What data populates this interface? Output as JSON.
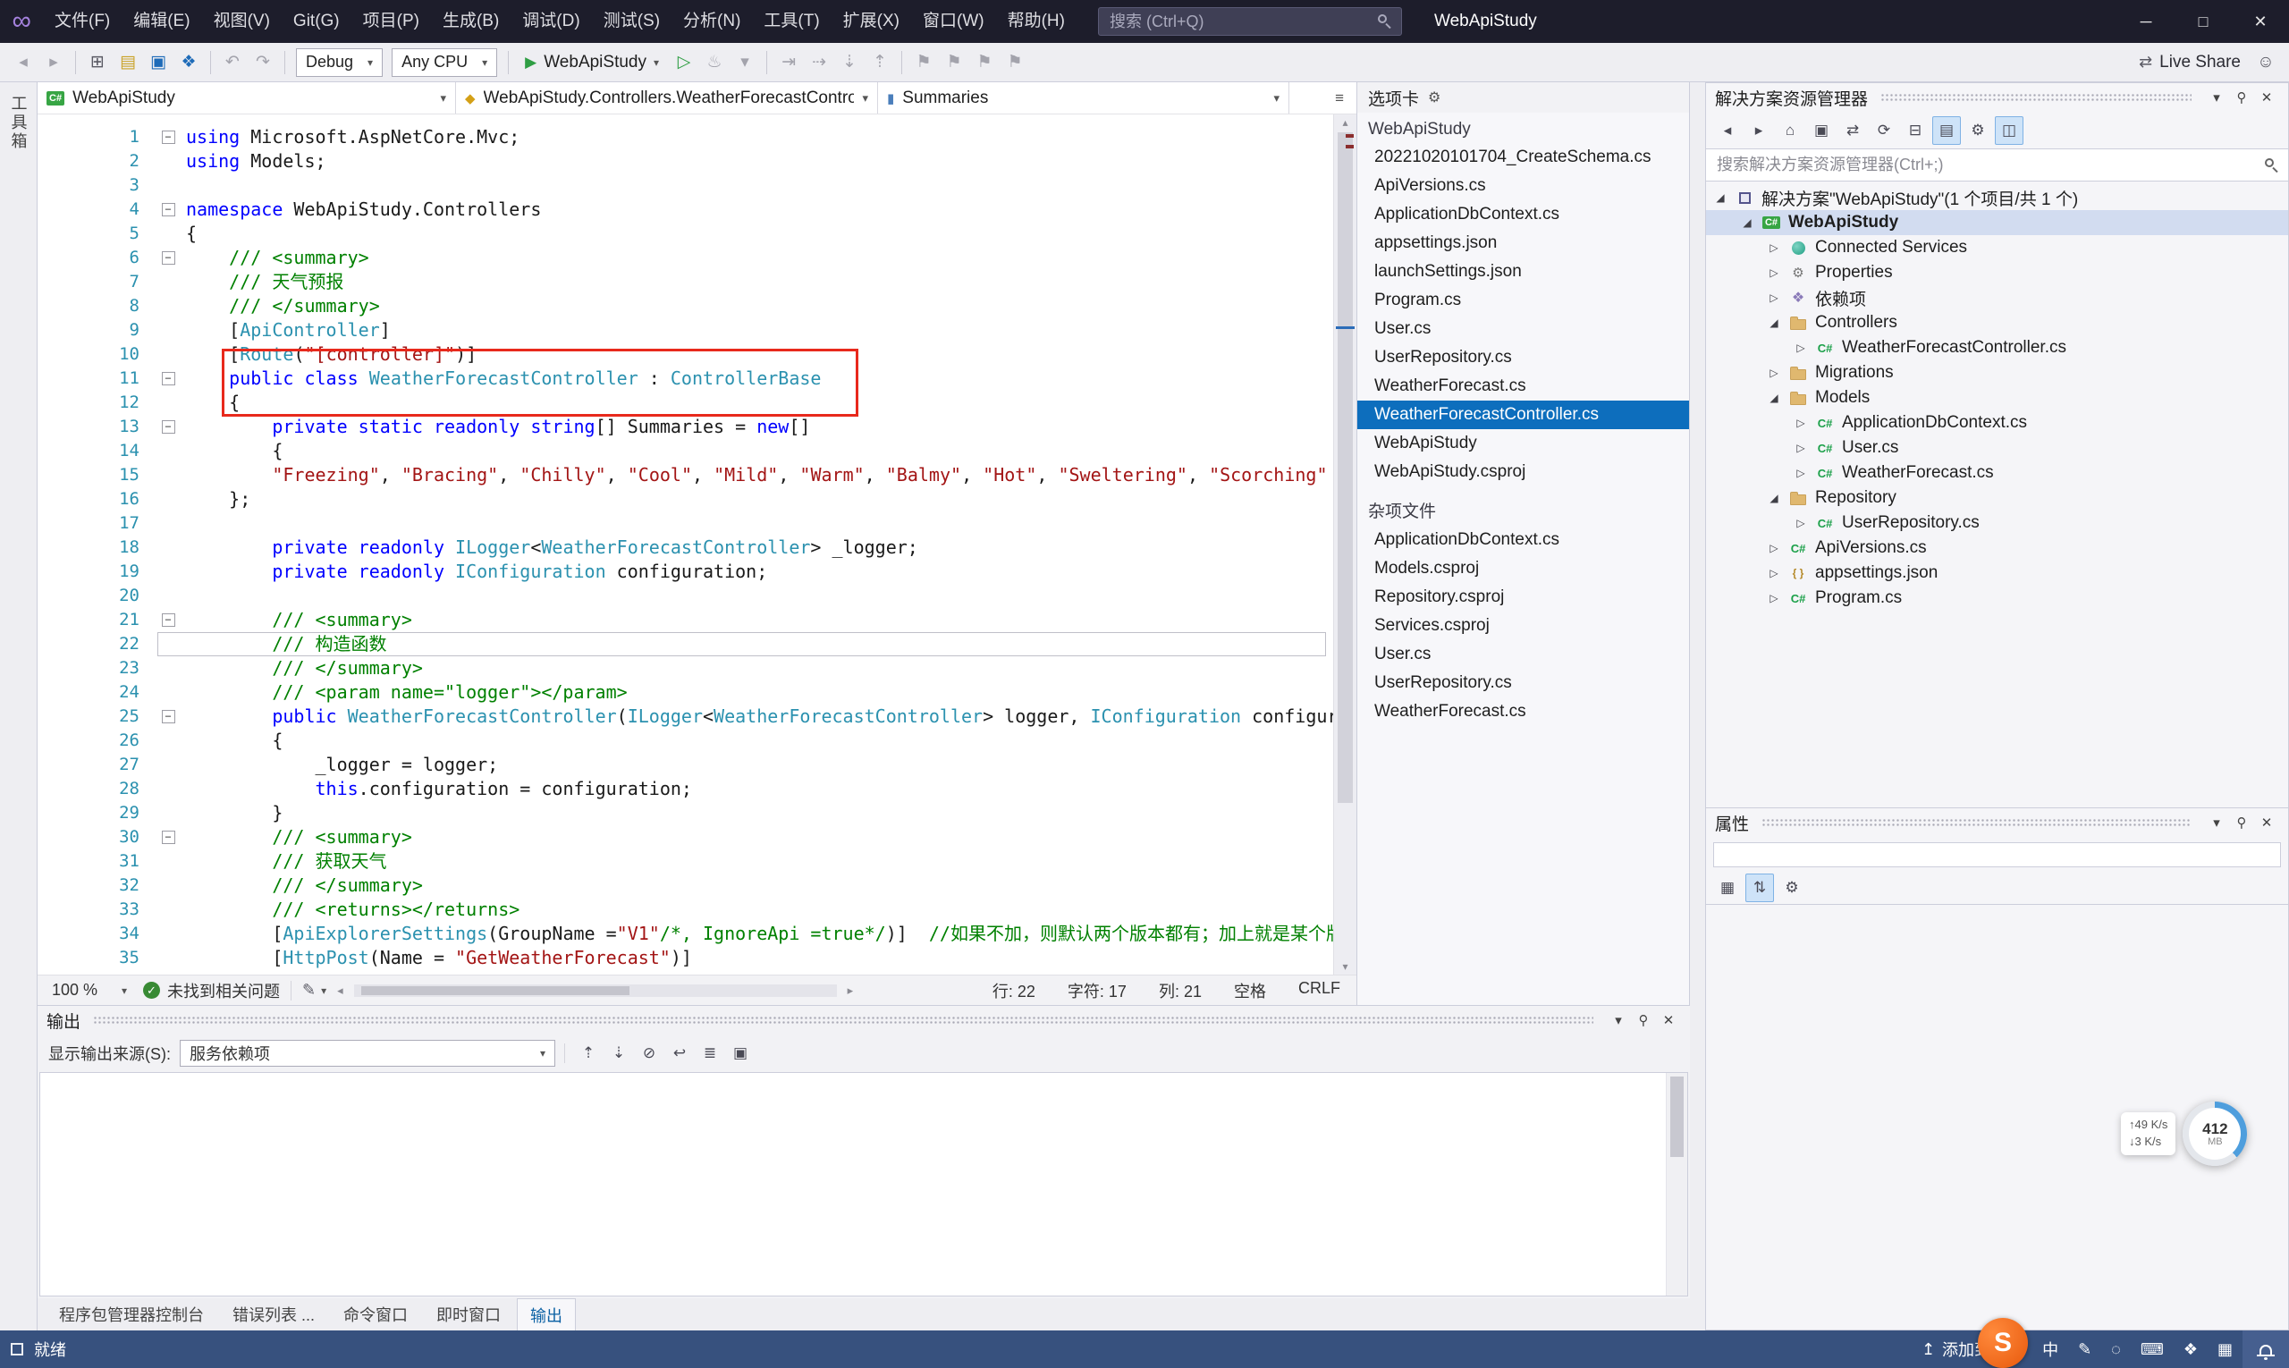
{
  "title_bar": {
    "logo_glyph": "∞",
    "menus": [
      "文件(F)",
      "编辑(E)",
      "视图(V)",
      "Git(G)",
      "项目(P)",
      "生成(B)",
      "调试(D)",
      "测试(S)",
      "分析(N)",
      "工具(T)",
      "扩展(X)",
      "窗口(W)",
      "帮助(H)"
    ],
    "search_placeholder": "搜索 (Ctrl+Q)",
    "window_title": "WebApiStudy",
    "window_buttons": [
      {
        "name": "minimize",
        "glyph": "─"
      },
      {
        "name": "maximize",
        "glyph": "□"
      },
      {
        "name": "close",
        "glyph": "✕"
      }
    ]
  },
  "toolbar": {
    "icons_left": [
      {
        "name": "nav-back",
        "glyph": "◂",
        "tone": "dim"
      },
      {
        "name": "nav-forward",
        "glyph": "▸",
        "tone": "dim"
      },
      {
        "name": "sep"
      },
      {
        "name": "new-project",
        "glyph": "⊞",
        "tone": "gray"
      },
      {
        "name": "open-file",
        "glyph": "▤",
        "tone": "amber"
      },
      {
        "name": "save",
        "glyph": "▣",
        "tone": "blue"
      },
      {
        "name": "save-all",
        "glyph": "❖",
        "tone": "blue"
      },
      {
        "name": "sep"
      },
      {
        "name": "undo",
        "glyph": "↶",
        "tone": "dim"
      },
      {
        "name": "redo",
        "glyph": "↷",
        "tone": "dim"
      },
      {
        "name": "sep"
      }
    ],
    "debug_config": "Debug",
    "platform": "Any CPU",
    "run_label": "WebApiStudy",
    "icons_right": [
      {
        "name": "start-without-debugging",
        "glyph": "▷",
        "tone": "green"
      },
      {
        "name": "hot-reload",
        "glyph": "♨",
        "tone": "dim"
      },
      {
        "name": "hot-reload-caret",
        "glyph": "▾",
        "tone": "dim"
      },
      {
        "name": "sep"
      },
      {
        "name": "break-all",
        "glyph": "⇥",
        "tone": "dim"
      },
      {
        "name": "step-over",
        "glyph": "⇢",
        "tone": "dim"
      },
      {
        "name": "step-into",
        "glyph": "⇣",
        "tone": "dim"
      },
      {
        "name": "step-out",
        "glyph": "⇡",
        "tone": "dim"
      },
      {
        "name": "sep"
      },
      {
        "name": "bookmark-toggle",
        "glyph": "⚑",
        "tone": "dim"
      },
      {
        "name": "bookmark-prev",
        "glyph": "⚑",
        "tone": "dim"
      },
      {
        "name": "bookmark-next",
        "glyph": "⚑",
        "tone": "dim"
      },
      {
        "name": "bookmark-clear",
        "glyph": "⚑",
        "tone": "dim"
      }
    ],
    "live_share": "Live Share"
  },
  "toolbox_tab": "工具箱",
  "breadcrumbs": [
    {
      "label": "WebApiStudy",
      "icon": "project"
    },
    {
      "label": "WebApiStudy.Controllers.WeatherForecastContro",
      "icon": "class"
    },
    {
      "label": "Summaries",
      "icon": "field"
    }
  ],
  "editor": {
    "current_line": 22,
    "zoom": "100 %",
    "health": "未找到相关问题",
    "caret": {
      "line": "行: 22",
      "chars": "字符: 17",
      "col": "列: 21",
      "spaces": "空格",
      "eol": "CRLF"
    },
    "code_lines": [
      {
        "n": 1,
        "fold": true,
        "t": [
          [
            "k",
            "using"
          ],
          [
            "p",
            " Microsoft.AspNetCore.Mvc;"
          ]
        ]
      },
      {
        "n": 2,
        "t": [
          [
            "k",
            "using"
          ],
          [
            "p",
            " Models;"
          ]
        ]
      },
      {
        "n": 3,
        "t": []
      },
      {
        "n": 4,
        "fold": true,
        "t": [
          [
            "k",
            "namespace"
          ],
          [
            "p",
            " WebApiStudy.Controllers"
          ]
        ]
      },
      {
        "n": 5,
        "t": [
          [
            "p",
            "{"
          ]
        ]
      },
      {
        "n": 6,
        "fold": true,
        "t": [
          [
            "c",
            "    /// <summary>"
          ]
        ]
      },
      {
        "n": 7,
        "t": [
          [
            "c",
            "    /// 天气预报"
          ]
        ]
      },
      {
        "n": 8,
        "t": [
          [
            "c",
            "    /// </summary>"
          ]
        ]
      },
      {
        "n": 9,
        "t": [
          [
            "p",
            "    ["
          ],
          [
            "t",
            "ApiController"
          ],
          [
            "p",
            "]"
          ]
        ]
      },
      {
        "n": 10,
        "t": [
          [
            "p",
            "    ["
          ],
          [
            "t",
            "Route"
          ],
          [
            "p",
            "("
          ],
          [
            "s",
            "\"[controller]\""
          ],
          [
            "p",
            ")]"
          ]
        ]
      },
      {
        "n": 11,
        "fold": true,
        "t": [
          [
            "p",
            "    "
          ],
          [
            "k",
            "public"
          ],
          [
            "p",
            " "
          ],
          [
            "k",
            "class"
          ],
          [
            "p",
            " "
          ],
          [
            "t",
            "WeatherForecastController"
          ],
          [
            "p",
            " : "
          ],
          [
            "t",
            "ControllerBase"
          ]
        ]
      },
      {
        "n": 12,
        "t": [
          [
            "p",
            "    {"
          ]
        ]
      },
      {
        "n": 13,
        "fold": true,
        "t": [
          [
            "p",
            "        "
          ],
          [
            "k",
            "private"
          ],
          [
            "p",
            " "
          ],
          [
            "k",
            "static"
          ],
          [
            "p",
            " "
          ],
          [
            "k",
            "readonly"
          ],
          [
            "p",
            " "
          ],
          [
            "k",
            "string"
          ],
          [
            "p",
            "[] Summaries = "
          ],
          [
            "k",
            "new"
          ],
          [
            "p",
            "[]"
          ]
        ]
      },
      {
        "n": 14,
        "t": [
          [
            "p",
            "        {"
          ]
        ]
      },
      {
        "n": 15,
        "t": [
          [
            "p",
            "        "
          ],
          [
            "s",
            "\"Freezing\""
          ],
          [
            "p",
            ", "
          ],
          [
            "s",
            "\"Bracing\""
          ],
          [
            "p",
            ", "
          ],
          [
            "s",
            "\"Chilly\""
          ],
          [
            "p",
            ", "
          ],
          [
            "s",
            "\"Cool\""
          ],
          [
            "p",
            ", "
          ],
          [
            "s",
            "\"Mild\""
          ],
          [
            "p",
            ", "
          ],
          [
            "s",
            "\"Warm\""
          ],
          [
            "p",
            ", "
          ],
          [
            "s",
            "\"Balmy\""
          ],
          [
            "p",
            ", "
          ],
          [
            "s",
            "\"Hot\""
          ],
          [
            "p",
            ", "
          ],
          [
            "s",
            "\"Sweltering\""
          ],
          [
            "p",
            ", "
          ],
          [
            "s",
            "\"Scorching\""
          ]
        ]
      },
      {
        "n": 16,
        "t": [
          [
            "p",
            "    };"
          ]
        ]
      },
      {
        "n": 17,
        "t": []
      },
      {
        "n": 18,
        "t": [
          [
            "p",
            "        "
          ],
          [
            "k",
            "private"
          ],
          [
            "p",
            " "
          ],
          [
            "k",
            "readonly"
          ],
          [
            "p",
            " "
          ],
          [
            "t",
            "ILogger"
          ],
          [
            "p",
            "<"
          ],
          [
            "t",
            "WeatherForecastController"
          ],
          [
            "p",
            "> _logger;"
          ]
        ]
      },
      {
        "n": 19,
        "t": [
          [
            "p",
            "        "
          ],
          [
            "k",
            "private"
          ],
          [
            "p",
            " "
          ],
          [
            "k",
            "readonly"
          ],
          [
            "p",
            " "
          ],
          [
            "t",
            "IConfiguration"
          ],
          [
            "p",
            " configuration;"
          ]
        ]
      },
      {
        "n": 20,
        "t": []
      },
      {
        "n": 21,
        "fold": true,
        "t": [
          [
            "c",
            "        /// <summary>"
          ]
        ]
      },
      {
        "n": 22,
        "t": [
          [
            "c",
            "        /// 构造函数"
          ]
        ]
      },
      {
        "n": 23,
        "t": [
          [
            "c",
            "        /// </summary>"
          ]
        ]
      },
      {
        "n": 24,
        "t": [
          [
            "c",
            "        /// <param name=\"logger\"></param>"
          ]
        ]
      },
      {
        "n": 25,
        "fold": true,
        "t": [
          [
            "p",
            "        "
          ],
          [
            "k",
            "public"
          ],
          [
            "p",
            " "
          ],
          [
            "t",
            "WeatherForecastController"
          ],
          [
            "p",
            "("
          ],
          [
            "t",
            "ILogger"
          ],
          [
            "p",
            "<"
          ],
          [
            "t",
            "WeatherForecastController"
          ],
          [
            "p",
            "> logger, "
          ],
          [
            "t",
            "IConfiguration"
          ],
          [
            "p",
            " configuration)"
          ]
        ]
      },
      {
        "n": 26,
        "t": [
          [
            "p",
            "        {"
          ]
        ]
      },
      {
        "n": 27,
        "t": [
          [
            "p",
            "            _logger = logger;"
          ]
        ]
      },
      {
        "n": 28,
        "t": [
          [
            "p",
            "            "
          ],
          [
            "k",
            "this"
          ],
          [
            "p",
            ".configuration = configuration;"
          ]
        ]
      },
      {
        "n": 29,
        "t": [
          [
            "p",
            "        }"
          ]
        ]
      },
      {
        "n": 30,
        "fold": true,
        "t": [
          [
            "c",
            "        /// <summary>"
          ]
        ]
      },
      {
        "n": 31,
        "t": [
          [
            "c",
            "        /// 获取天气"
          ]
        ]
      },
      {
        "n": 32,
        "t": [
          [
            "c",
            "        /// </summary>"
          ]
        ]
      },
      {
        "n": 33,
        "t": [
          [
            "c",
            "        /// <returns></returns>"
          ]
        ]
      },
      {
        "n": 34,
        "t": [
          [
            "p",
            "        ["
          ],
          [
            "t",
            "ApiExplorerSettings"
          ],
          [
            "p",
            "(GroupName ="
          ],
          [
            "s",
            "\"V1\""
          ],
          [
            "c",
            "/*, IgnoreApi =true*/"
          ],
          [
            "p",
            ")]  "
          ],
          [
            "c",
            "//如果不加，则默认两个版本都有；加上就是某个版本独有"
          ]
        ]
      },
      {
        "n": 35,
        "t": [
          [
            "p",
            "        ["
          ],
          [
            "t",
            "HttpPost"
          ],
          [
            "p",
            "(Name = "
          ],
          [
            "s",
            "\"GetWeatherForecast\""
          ],
          [
            "p",
            ")]"
          ]
        ]
      }
    ]
  },
  "tabs_panel": {
    "title": "选项卡",
    "groups": [
      {
        "header": "WebApiStudy",
        "items": [
          {
            "label": "20221020101704_CreateSchema.cs"
          },
          {
            "label": "ApiVersions.cs"
          },
          {
            "label": "ApplicationDbContext.cs"
          },
          {
            "label": "appsettings.json"
          },
          {
            "label": "launchSettings.json"
          },
          {
            "label": "Program.cs"
          },
          {
            "label": "User.cs"
          },
          {
            "label": "UserRepository.cs"
          },
          {
            "label": "WeatherForecast.cs"
          },
          {
            "label": "WeatherForecastController.cs",
            "selected": true
          },
          {
            "label": "WebApiStudy"
          },
          {
            "label": "WebApiStudy.csproj"
          }
        ]
      },
      {
        "header": "杂项文件",
        "items": [
          {
            "label": "ApplicationDbContext.cs"
          },
          {
            "label": "Models.csproj"
          },
          {
            "label": "Repository.csproj"
          },
          {
            "label": "Services.csproj"
          },
          {
            "label": "User.cs"
          },
          {
            "label": "UserRepository.cs"
          },
          {
            "label": "WeatherForecast.cs"
          }
        ]
      }
    ]
  },
  "panel_controls": [
    {
      "name": "window-position",
      "glyph": "▾"
    },
    {
      "name": "pin",
      "glyph": "⚲"
    },
    {
      "name": "close",
      "glyph": "✕"
    }
  ],
  "solution_explorer": {
    "title": "解决方案资源管理器",
    "search_placeholder": "搜索解决方案资源管理器(Ctrl+;)",
    "toolbar_icons": [
      {
        "name": "back",
        "glyph": "◂",
        "tone": "dim"
      },
      {
        "name": "forward",
        "glyph": "▸",
        "tone": "dim"
      },
      {
        "name": "home",
        "glyph": "⌂",
        "tone": "gray"
      },
      {
        "name": "switch-views",
        "glyph": "▣",
        "tone": "gray"
      },
      {
        "name": "sync-with-active-document",
        "glyph": "⇄",
        "tone": "gray"
      },
      {
        "name": "refresh",
        "glyph": "⟳",
        "tone": "gray"
      },
      {
        "name": "collapse-all",
        "glyph": "⊟",
        "tone": "gray"
      },
      {
        "name": "show-all-files",
        "glyph": "▤",
        "tone": "gray",
        "active": true
      },
      {
        "name": "properties",
        "glyph": "⚙",
        "tone": "gray"
      },
      {
        "name": "preview-selected-items",
        "glyph": "◫",
        "tone": "gray",
        "active": true
      }
    ],
    "tree": [
      {
        "depth": 0,
        "expand": "open",
        "icon": "solution",
        "label": "解决方案\"WebApiStudy\"(1 个项目/共 1 个)"
      },
      {
        "depth": 1,
        "expand": "open",
        "icon": "project",
        "label": "WebApiStudy",
        "bold": true,
        "selected": true
      },
      {
        "depth": 2,
        "expand": "closed",
        "icon": "services",
        "label": "Connected Services"
      },
      {
        "depth": 2,
        "expand": "closed",
        "icon": "properties",
        "label": "Properties"
      },
      {
        "depth": 2,
        "expand": "closed",
        "icon": "dependencies",
        "label": "依赖项"
      },
      {
        "depth": 2,
        "expand": "open",
        "icon": "folder",
        "label": "Controllers"
      },
      {
        "depth": 3,
        "expand": "closed",
        "icon": "csfile",
        "label": "WeatherForecastController.cs"
      },
      {
        "depth": 2,
        "expand": "closed",
        "icon": "folder",
        "label": "Migrations"
      },
      {
        "depth": 2,
        "expand": "open",
        "icon": "folder",
        "label": "Models"
      },
      {
        "depth": 3,
        "expand": "closed",
        "icon": "csfile",
        "label": "ApplicationDbContext.cs"
      },
      {
        "depth": 3,
        "expand": "closed",
        "icon": "csfile",
        "label": "User.cs"
      },
      {
        "depth": 3,
        "expand": "closed",
        "icon": "csfile",
        "label": "WeatherForecast.cs"
      },
      {
        "depth": 2,
        "expand": "open",
        "icon": "folder",
        "label": "Repository"
      },
      {
        "depth": 3,
        "expand": "closed",
        "icon": "csfile",
        "label": "UserRepository.cs"
      },
      {
        "depth": 2,
        "expand": "closed",
        "icon": "csfile",
        "label": "ApiVersions.cs"
      },
      {
        "depth": 2,
        "expand": "closed",
        "icon": "json",
        "label": "appsettings.json"
      },
      {
        "depth": 2,
        "expand": "closed",
        "icon": "csfile",
        "label": "Program.cs"
      }
    ]
  },
  "properties_panel": {
    "title": "属性",
    "toolbar_icons": [
      {
        "name": "categorized",
        "glyph": "▦",
        "tone": "gray"
      },
      {
        "name": "alphabetical",
        "glyph": "⇅",
        "tone": "gray",
        "active": true
      },
      {
        "name": "property-pages",
        "glyph": "⚙",
        "tone": "gray"
      }
    ]
  },
  "output_panel": {
    "title": "输出",
    "source_label": "显示输出来源(S):",
    "source_value": "服务依赖项",
    "toolbar_icons": [
      {
        "name": "prev-message",
        "glyph": "⇡",
        "tone": "dim"
      },
      {
        "name": "next-message",
        "glyph": "⇣",
        "tone": "dim"
      },
      {
        "name": "clear-all",
        "glyph": "⊘",
        "tone": "gray"
      },
      {
        "name": "word-wrap",
        "glyph": "↩",
        "tone": "gray"
      },
      {
        "name": "toggle-lines",
        "glyph": "≣",
        "tone": "gray"
      },
      {
        "name": "pin-output",
        "glyph": "▣",
        "tone": "gray"
      }
    ]
  },
  "bottom_tabs": [
    {
      "label": "程序包管理器控制台"
    },
    {
      "label": "错误列表 ..."
    },
    {
      "label": "命令窗口"
    },
    {
      "label": "即时窗口"
    },
    {
      "label": "输出",
      "active": true
    }
  ],
  "status_bar": {
    "ready": "就绪",
    "push_glyph": "↥",
    "add_to_source": "添加到源...",
    "icons": [
      {
        "name": "ime-chinese",
        "glyph": "中"
      },
      {
        "name": "pen",
        "glyph": "✎"
      },
      {
        "name": "dictation-mic",
        "glyph": "◌"
      },
      {
        "name": "keyboard",
        "glyph": "⌨"
      },
      {
        "name": "layout",
        "glyph": "❖"
      },
      {
        "name": "grid",
        "glyph": "▦"
      }
    ]
  },
  "overlay": {
    "net_up": "↑49 K/s",
    "net_down": "↓3 K/s",
    "memory_value": "412",
    "memory_unit": "MB",
    "recorder_letter": "S"
  }
}
